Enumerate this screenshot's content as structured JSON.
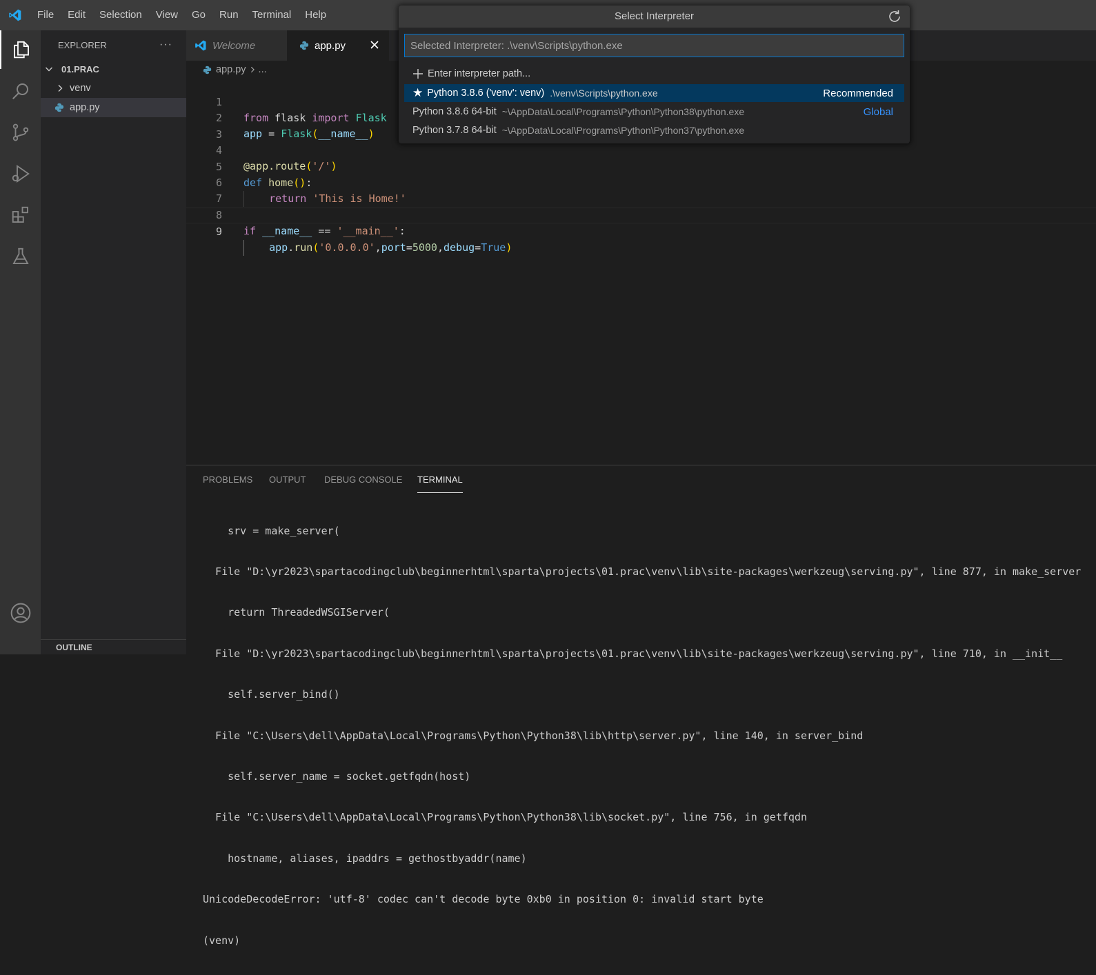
{
  "titlebar": {
    "menu": [
      "File",
      "Edit",
      "Selection",
      "View",
      "Go",
      "Run",
      "Terminal",
      "Help"
    ]
  },
  "activitybar": {
    "items": [
      "explorer-icon",
      "search-icon",
      "source-control-icon",
      "run-debug-icon",
      "extensions-icon",
      "testing-icon",
      "account-icon"
    ]
  },
  "sidebar": {
    "title": "EXPLORER",
    "more": "···",
    "folder": "01.PRAC",
    "items": [
      {
        "label": "venv",
        "type": "folder"
      },
      {
        "label": "app.py",
        "type": "file"
      }
    ],
    "outline": "OUTLINE"
  },
  "tabs": [
    {
      "label": "Welcome",
      "active": false
    },
    {
      "label": "app.py",
      "active": true
    }
  ],
  "breadcrumb": {
    "file": "app.py",
    "rest": "..."
  },
  "editor": {
    "line_numbers": [
      "1",
      "2",
      "3",
      "4",
      "5",
      "6",
      "7",
      "8",
      "9"
    ],
    "current_line": "9"
  },
  "panel": {
    "tabs": [
      "PROBLEMS",
      "OUTPUT",
      "DEBUG CONSOLE",
      "TERMINAL"
    ],
    "active_tab": "TERMINAL",
    "terminal_lines": [
      "    srv = make_server(",
      "  File \"D:\\yr2023\\spartacodingclub\\beginnerhtml\\sparta\\projects\\01.prac\\venv\\lib\\site-packages\\werkzeug\\serving.py\", line 877, in make_server",
      "    return ThreadedWSGIServer(",
      "  File \"D:\\yr2023\\spartacodingclub\\beginnerhtml\\sparta\\projects\\01.prac\\venv\\lib\\site-packages\\werkzeug\\serving.py\", line 710, in __init__",
      "    self.server_bind()",
      "  File \"C:\\Users\\dell\\AppData\\Local\\Programs\\Python\\Python38\\lib\\http\\server.py\", line 140, in server_bind",
      "    self.server_name = socket.getfqdn(host)",
      "  File \"C:\\Users\\dell\\AppData\\Local\\Programs\\Python\\Python38\\lib\\socket.py\", line 756, in getfqdn",
      "    hostname, aliases, ipaddrs = gethostbyaddr(name)",
      "UnicodeDecodeError: 'utf-8' codec can't decode byte 0xb0 in position 0: invalid start byte",
      "(venv)"
    ]
  },
  "quickpick": {
    "title": "Select Interpreter",
    "input_value": "Selected Interpreter: .\\venv\\Scripts\\python.exe",
    "enter_path": "Enter interpreter path...",
    "options": [
      {
        "label": "Python 3.8.6 ('venv': venv)",
        "path": ".\\venv\\Scripts\\python.exe",
        "tag": "Recommended",
        "selected": true
      },
      {
        "label": "Python 3.8.6 64-bit",
        "path": "~\\AppData\\Local\\Programs\\Python\\Python38\\python.exe",
        "tag": "Global",
        "selected": false
      },
      {
        "label": "Python 3.7.8 64-bit",
        "path": "~\\AppData\\Local\\Programs\\Python\\Python37\\python.exe",
        "tag": "",
        "selected": false
      }
    ]
  },
  "colors": {
    "accent": "#0078d4",
    "selection": "#04395e",
    "global_tag": "#3794ff"
  }
}
